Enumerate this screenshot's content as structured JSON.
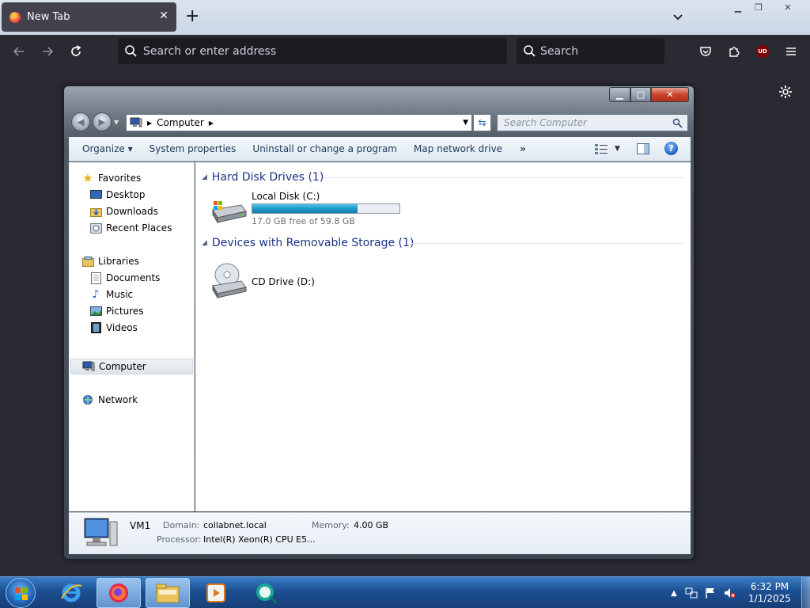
{
  "browser": {
    "tab_title": "New Tab",
    "urlbar_placeholder": "Search or enter address",
    "searchbar_placeholder": "Search",
    "extension_badge": "UD"
  },
  "explorer": {
    "address": "Computer",
    "search_placeholder": "Search Computer",
    "commands": {
      "organize": "Organize",
      "system_properties": "System properties",
      "uninstall": "Uninstall or change a program",
      "map_drive": "Map network drive",
      "more": "»"
    },
    "nav": {
      "favorites": "Favorites",
      "desktop": "Desktop",
      "downloads": "Downloads",
      "recent_places": "Recent Places",
      "libraries": "Libraries",
      "documents": "Documents",
      "music": "Music",
      "pictures": "Pictures",
      "videos": "Videos",
      "computer": "Computer",
      "network": "Network"
    },
    "groups": {
      "hard_disk": "Hard Disk Drives (1)",
      "removable": "Devices with Removable Storage (1)"
    },
    "drives": {
      "c_name": "Local Disk (C:)",
      "c_free": "17.0 GB free of 59.8 GB",
      "c_used_fraction": 0.716,
      "d_name": "CD Drive (D:)"
    },
    "details": {
      "computer_name": "VM1",
      "domain_label": "Domain:",
      "domain_value": "collabnet.local",
      "memory_label": "Memory:",
      "memory_value": "4.00 GB",
      "processor_label": "Processor:",
      "processor_value": "Intel(R) Xeon(R) CPU E5..."
    }
  },
  "taskbar": {
    "time": "6:32 PM",
    "date": "1/1/2025"
  },
  "colors": {
    "firefox_dark": "#2b2a33",
    "explorer_link": "#1e3287",
    "progress_blue": "#1d9bc6",
    "taskbar_blue": "#1c4f93"
  }
}
